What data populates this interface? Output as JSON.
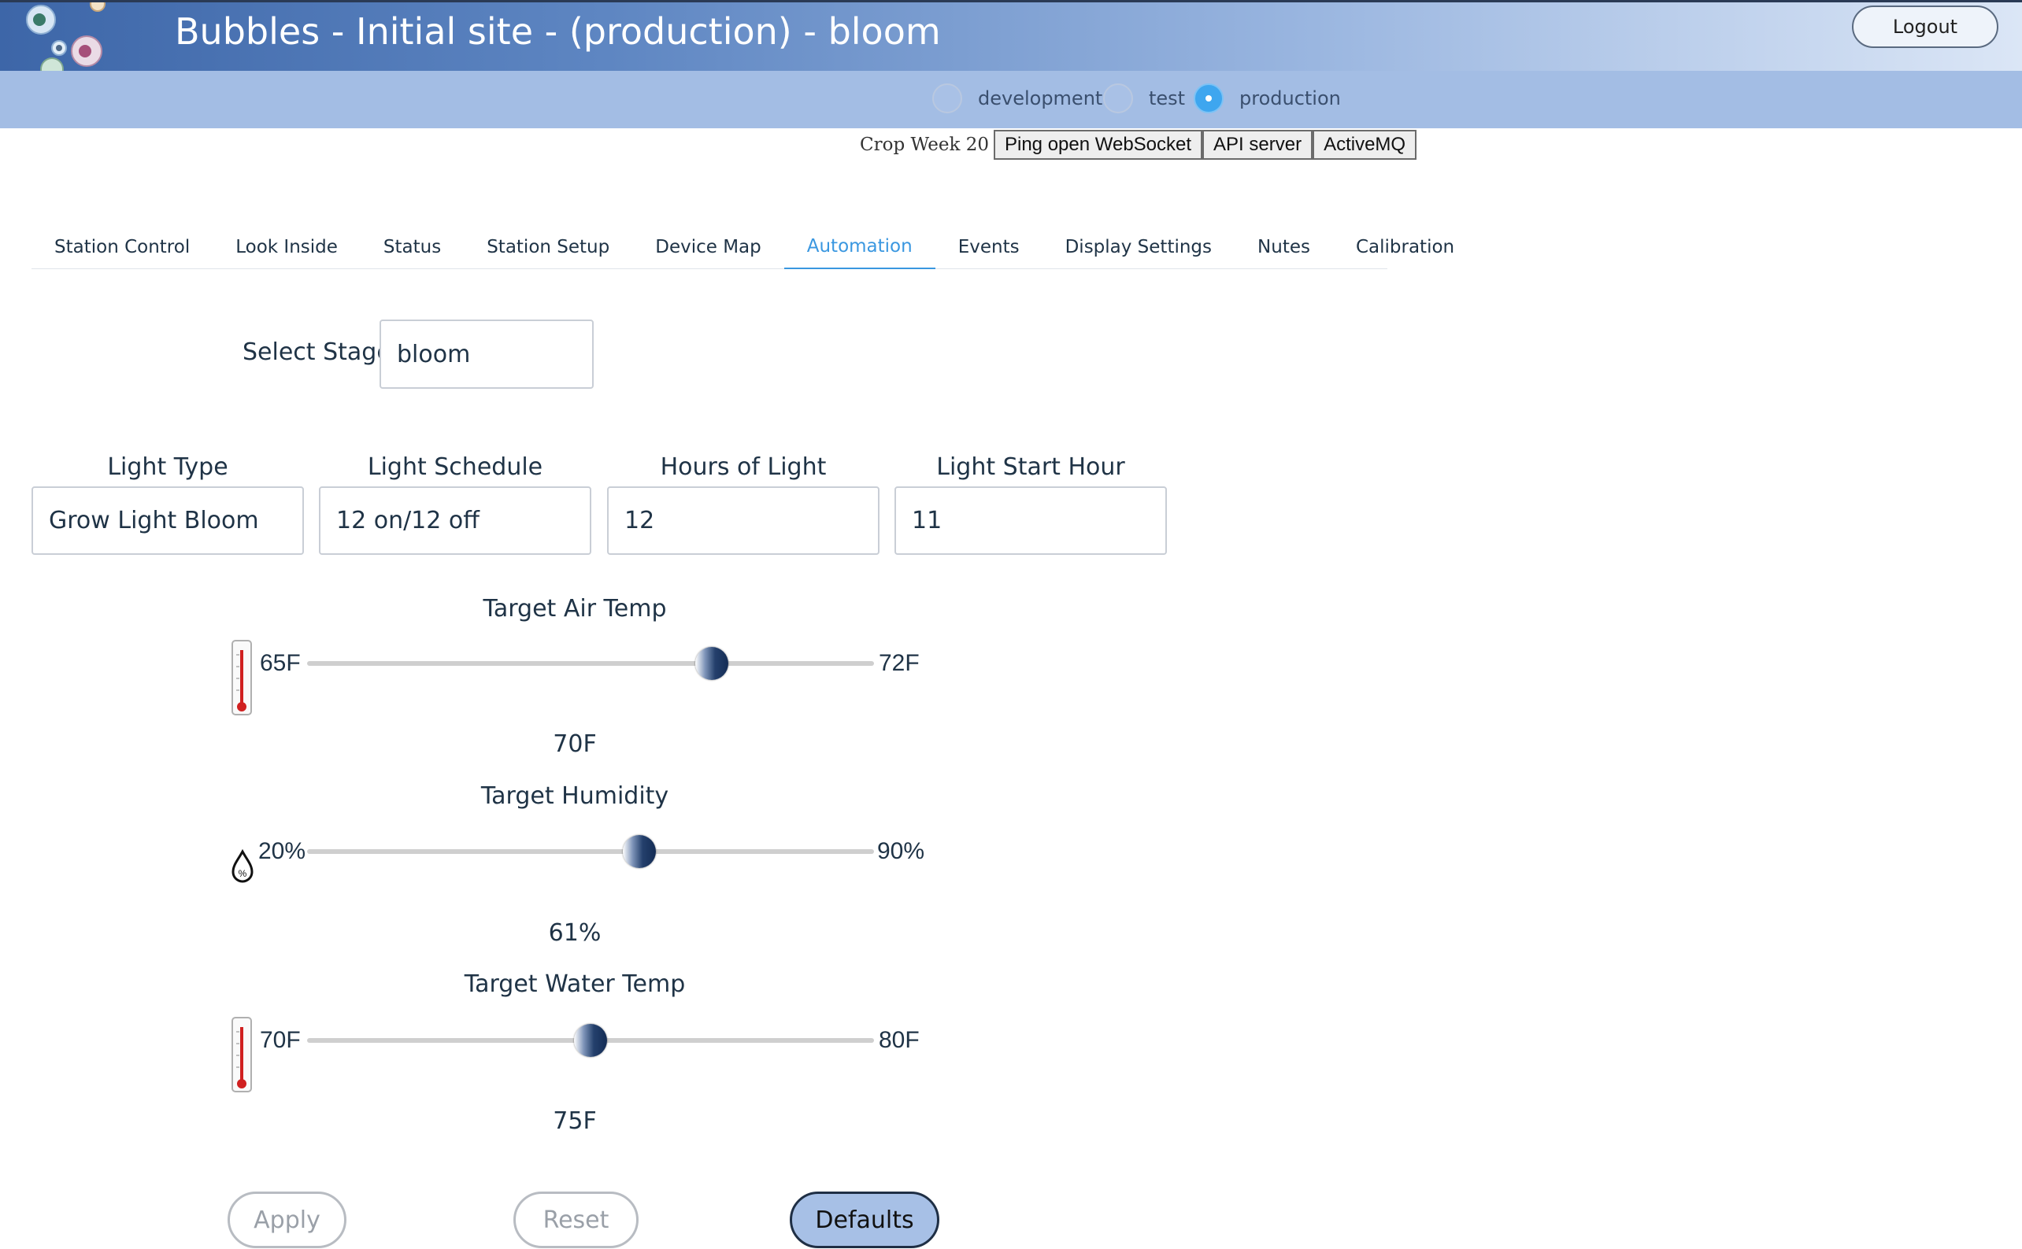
{
  "app": {
    "title": "Bubbles - Initial site - (production) - bloom",
    "logout_label": "Logout"
  },
  "environments": [
    {
      "label": "development",
      "selected": false
    },
    {
      "label": "test",
      "selected": false
    },
    {
      "label": "production",
      "selected": true
    }
  ],
  "toolbar": {
    "crop_week": "Crop Week 20",
    "buttons": [
      "Ping open WebSocket",
      "API server",
      "ActiveMQ"
    ]
  },
  "tabs": [
    {
      "label": "Station Control",
      "active": false
    },
    {
      "label": "Look Inside",
      "active": false
    },
    {
      "label": "Status",
      "active": false
    },
    {
      "label": "Station Setup",
      "active": false
    },
    {
      "label": "Device Map",
      "active": false
    },
    {
      "label": "Automation",
      "active": true
    },
    {
      "label": "Events",
      "active": false
    },
    {
      "label": "Display Settings",
      "active": false
    },
    {
      "label": "Nutes",
      "active": false
    },
    {
      "label": "Calibration",
      "active": false
    }
  ],
  "stage": {
    "label": "Select Stage",
    "value": "bloom"
  },
  "light": {
    "type_label": "Light Type",
    "type_value": "Grow Light Bloom",
    "schedule_label": "Light Schedule",
    "schedule_value": "12 on/12 off",
    "hours_label": "Hours of Light",
    "hours_value": "12",
    "start_label": "Light Start Hour",
    "start_value": "11"
  },
  "sliders": {
    "air_temp": {
      "title": "Target Air Temp",
      "min_label": "65F",
      "max_label": "72F",
      "value_label": "70F",
      "min": 65,
      "max": 72,
      "value": 70,
      "icon": "thermometer-icon"
    },
    "humidity": {
      "title": "Target Humidity",
      "min_label": "20%",
      "max_label": "90%",
      "value_label": "61%",
      "min": 20,
      "max": 90,
      "value": 61,
      "icon": "humidity-drop-icon"
    },
    "water_temp": {
      "title": "Target Water Temp",
      "min_label": "70F",
      "max_label": "80F",
      "value_label": "75F",
      "min": 70,
      "max": 80,
      "value": 75,
      "icon": "thermometer-icon"
    }
  },
  "actions": {
    "apply": "Apply",
    "reset": "Reset",
    "defaults": "Defaults"
  },
  "colors": {
    "accent": "#3a97e0",
    "header_dark": "#3d66a8",
    "env_bar": "#a3bde4",
    "defaults_button": "#a7c0e6"
  }
}
